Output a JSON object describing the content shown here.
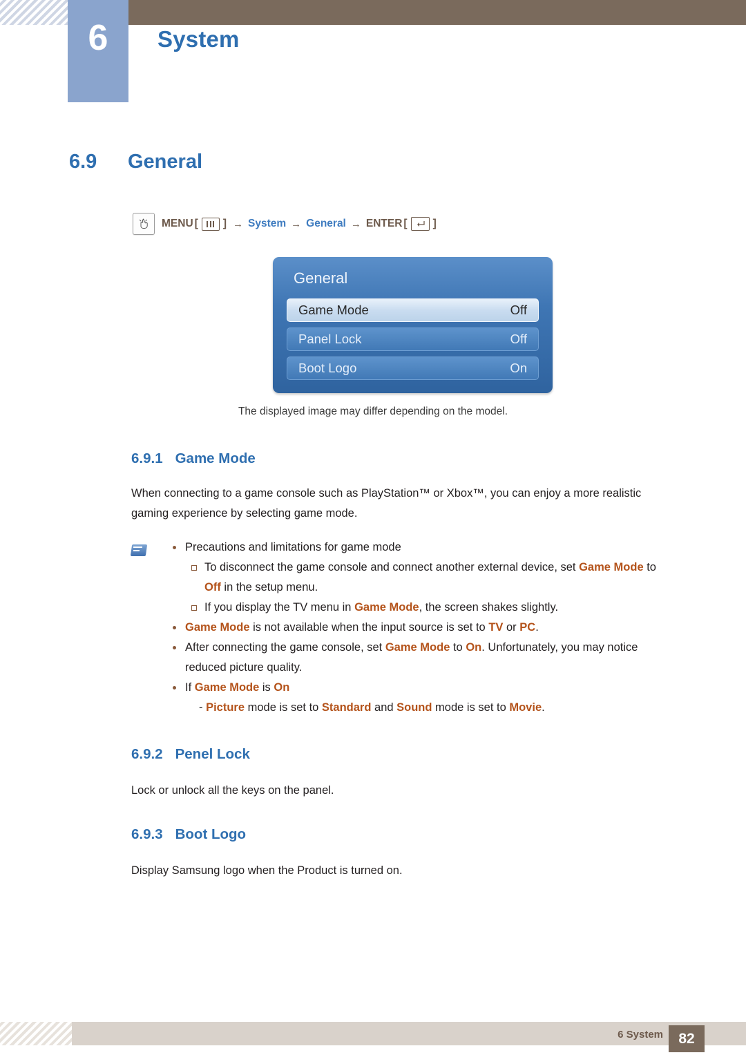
{
  "header": {
    "chapter_number": "6",
    "chapter_title": "System"
  },
  "section": {
    "number": "6.9",
    "title": "General"
  },
  "menu_path": {
    "icon": "hand-press-icon",
    "menu_label": "MENU",
    "menu_key_icon": "menu-key-icon",
    "arrow": "→",
    "step1": "System",
    "step2": "General",
    "enter_label": "ENTER",
    "enter_key_icon": "enter-key-icon",
    "bracket_open": "[",
    "bracket_close": "]"
  },
  "osd": {
    "title": "General",
    "rows": [
      {
        "label": "Game Mode",
        "value": "Off"
      },
      {
        "label": "Panel Lock",
        "value": "Off"
      },
      {
        "label": "Boot Logo",
        "value": "On"
      }
    ],
    "note": "The displayed image may differ depending on the model."
  },
  "subsections": {
    "game_mode": {
      "number": "6.9.1",
      "title": "Game Mode",
      "paragraph_line1": "When connecting to a game console such as PlayStation™ or Xbox™, you can enjoy a more realistic",
      "paragraph_line2": "gaming experience by selecting game mode.",
      "note_icon": "note-icon",
      "bullets": {
        "b0": "Precautions and limitations for game mode",
        "b0_sub1_pre": "To disconnect the game console and connect another external device, set ",
        "b0_sub1_kw": "Game Mode",
        "b0_sub1_mid": " to",
        "b0_sub1_line2_kw": "Off",
        "b0_sub1_line2_post": " in the setup menu.",
        "b0_sub2_pre": "If you display the TV menu in ",
        "b0_sub2_kw": "Game Mode",
        "b0_sub2_post": ", the screen shakes slightly.",
        "b1_kw": "Game Mode",
        "b1_mid": " is not available when the input source is set to ",
        "b1_kw2": "TV",
        "b1_or": " or ",
        "b1_kw3": "PC",
        "b1_end": ".",
        "b2_pre": "After connecting the game console, set ",
        "b2_kw": "Game Mode",
        "b2_mid": " to ",
        "b2_kw2": "On",
        "b2_post": ". Unfortunately, you may notice",
        "b2_line2": "reduced picture quality.",
        "b3_pre": "If ",
        "b3_kw": "Game Mode",
        "b3_mid": " is ",
        "b3_kw2": "On",
        "b3_sub_dash": "- ",
        "b3_sub_kw1": "Picture",
        "b3_sub_t1": " mode is set to ",
        "b3_sub_kw2": "Standard",
        "b3_sub_t2": " and ",
        "b3_sub_kw3": "Sound",
        "b3_sub_t3": " mode is set to ",
        "b3_sub_kw4": "Movie",
        "b3_sub_t4": "."
      }
    },
    "panel_lock": {
      "number": "6.9.2",
      "title": "Penel Lock",
      "paragraph": "Lock or unlock all the keys on the panel."
    },
    "boot_logo": {
      "number": "6.9.3",
      "title": "Boot Logo",
      "paragraph": "Display Samsung logo when the Product is turned on."
    }
  },
  "footer": {
    "text": "6 System",
    "page": "82"
  }
}
